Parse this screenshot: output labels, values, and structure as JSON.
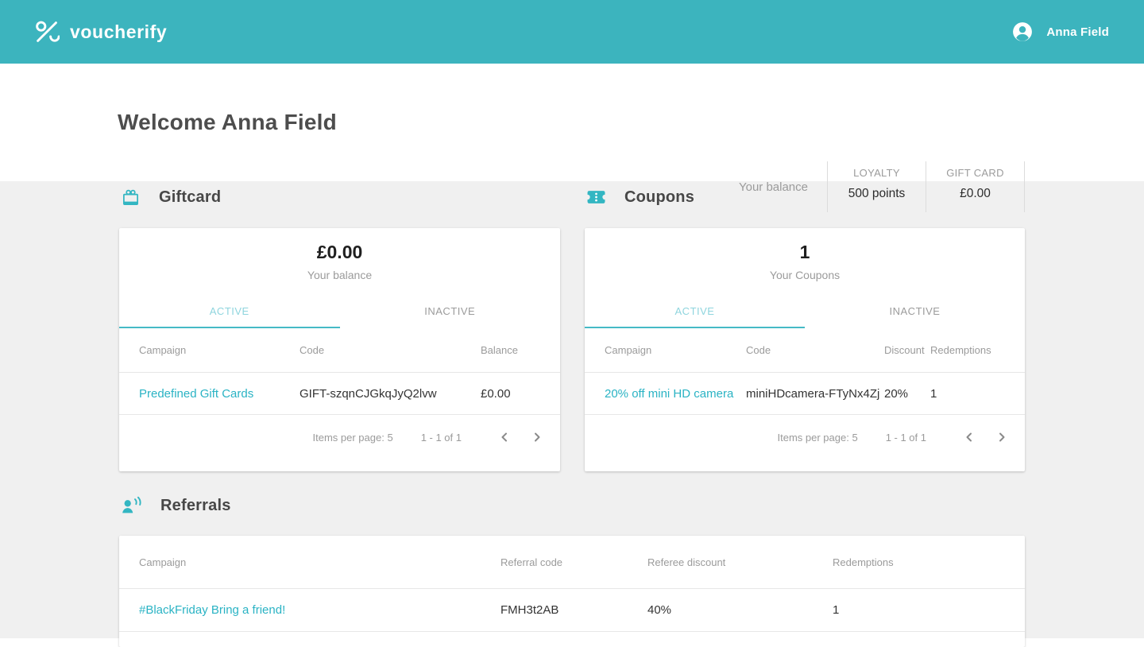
{
  "colors": {
    "topbar_teal": "#3cb4be",
    "icon_teal": "#33b6c2",
    "link_teal": "#2ab3c4",
    "active_tab_text": "#8fd5de",
    "active_tab_underline": "#45bac6",
    "background_gray": "#f0f0f0"
  },
  "topbar": {
    "brand": "voucherify",
    "user": "Anna Field"
  },
  "header": {
    "title": "Welcome Anna Field",
    "balance_label": "Your balance",
    "loyalty": {
      "label": "LOYALTY",
      "value": "500 points"
    },
    "giftcard": {
      "label": "GIFT CARD",
      "value": "£0.00"
    }
  },
  "giftcard_section": {
    "title": "Giftcard",
    "summary_value": "£0.00",
    "summary_label": "Your balance",
    "tab_active": "ACTIVE",
    "tab_inactive": "INACTIVE",
    "col_campaign": "Campaign",
    "col_code": "Code",
    "col_balance": "Balance",
    "row": {
      "campaign": "Predefined Gift Cards",
      "code": "GIFT-szqnCJGkqJyQ2lvw",
      "balance": "£0.00"
    },
    "pagination": {
      "items_per_page": "Items per page: 5",
      "range": "1 - 1 of 1"
    }
  },
  "coupons_section": {
    "title": "Coupons",
    "summary_value": "1",
    "summary_label": "Your Coupons",
    "tab_active": "ACTIVE",
    "tab_inactive": "INACTIVE",
    "col_campaign": "Campaign",
    "col_code": "Code",
    "col_discount": "Discount",
    "col_redemptions": "Redemptions",
    "row": {
      "campaign": "20% off mini HD camera",
      "code": "miniHDcamera-FTyNx4Zj",
      "discount": "20%",
      "redemptions": "1"
    },
    "pagination": {
      "items_per_page": "Items per page: 5",
      "range": "1 - 1 of 1"
    }
  },
  "referrals_section": {
    "title": "Referrals",
    "col_campaign": "Campaign",
    "col_code": "Referral code",
    "col_discount": "Referee discount",
    "col_redemptions": "Redemptions",
    "row": {
      "campaign": "#BlackFriday Bring a friend!",
      "code": "FMH3t2AB",
      "discount": "40%",
      "redemptions": "1"
    }
  }
}
